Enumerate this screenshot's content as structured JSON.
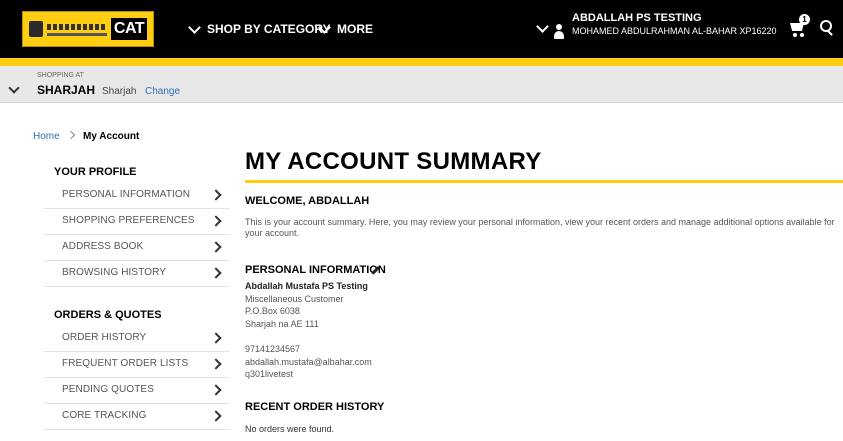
{
  "header": {
    "nav": [
      "SHOP BY CATEGORY",
      "MORE"
    ],
    "user_name": "ABDALLAH PS TESTING",
    "user_sub": "MOHAMED ABDULRAHMAN AL-BAHAR XP16220",
    "cart_count": "1",
    "logo_text": "CAT"
  },
  "shopping_at": {
    "label": "SHOPPING AT",
    "location": "SHARJAH",
    "city": "Sharjah",
    "change": "Change"
  },
  "breadcrumb": {
    "home": "Home",
    "current": "My Account"
  },
  "sidebar": {
    "your_profile": {
      "heading": "YOUR PROFILE",
      "items": [
        "PERSONAL INFORMATION",
        "SHOPPING PREFERENCES",
        "ADDRESS BOOK",
        "BROWSING HISTORY"
      ]
    },
    "orders_quotes": {
      "heading": "ORDERS & QUOTES",
      "items": [
        "ORDER HISTORY",
        "FREQUENT ORDER LISTS",
        "PENDING QUOTES",
        "CORE TRACKING"
      ]
    }
  },
  "main": {
    "title": "MY ACCOUNT SUMMARY",
    "welcome": "WELCOME, ABDALLAH",
    "intro": "This is your account summary. Here, you may review your personal information, view your recent orders and manage additional options available for your account.",
    "personal_info": {
      "heading": "PERSONAL INFORMATION",
      "name": "Abdallah Mustafa PS Testing",
      "type": "Miscellaneous Customer",
      "po": "P.O.Box 6038",
      "city": "Sharjah na AE 111",
      "phone": "97141234567",
      "email": "abdallah.mustafa@albahar.com",
      "user_id": "q301livetest"
    },
    "recent_orders": {
      "heading": "RECENT ORDER HISTORY",
      "empty": "No orders were found."
    }
  },
  "colors": {
    "brand_yellow": "#ffcd11",
    "link_blue": "#2b6fb6",
    "topbar": "#000000"
  }
}
